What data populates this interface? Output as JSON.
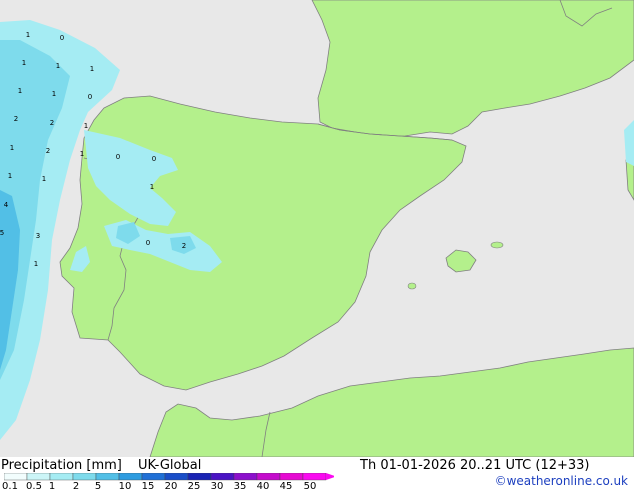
{
  "footer": {
    "title": "Precipitation [mm]",
    "model": "UK-Global",
    "valid": "Th 01-01-2026 20..21 UTC (12+33)",
    "credit": "©weatheronline.co.uk"
  },
  "legend": {
    "ticks": [
      "0.1",
      "0.5",
      "1",
      "2",
      "5",
      "10",
      "15",
      "20",
      "25",
      "30",
      "35",
      "40",
      "45",
      "50"
    ],
    "colors": [
      "#f2fdfd",
      "#ccf5f7",
      "#a5ecf3",
      "#7edbec",
      "#52bfe6",
      "#2e9ce0",
      "#2070d6",
      "#1a4ec8",
      "#1a24b4",
      "#4a14c4",
      "#8c10cc",
      "#c40ccc",
      "#e60ad2",
      "#fa0af0"
    ]
  },
  "map": {
    "land_color": "#b4f08c",
    "sea_color": "#e8e8e8",
    "border_color": "#808080",
    "labels": [
      "1",
      "0",
      "1",
      "1",
      "1",
      "1",
      "1",
      "0",
      "2",
      "2",
      "1",
      "1",
      "2",
      "1",
      "1",
      "1",
      "4",
      "0",
      "1",
      "0",
      "5",
      "3",
      "0",
      "2",
      "1"
    ]
  }
}
